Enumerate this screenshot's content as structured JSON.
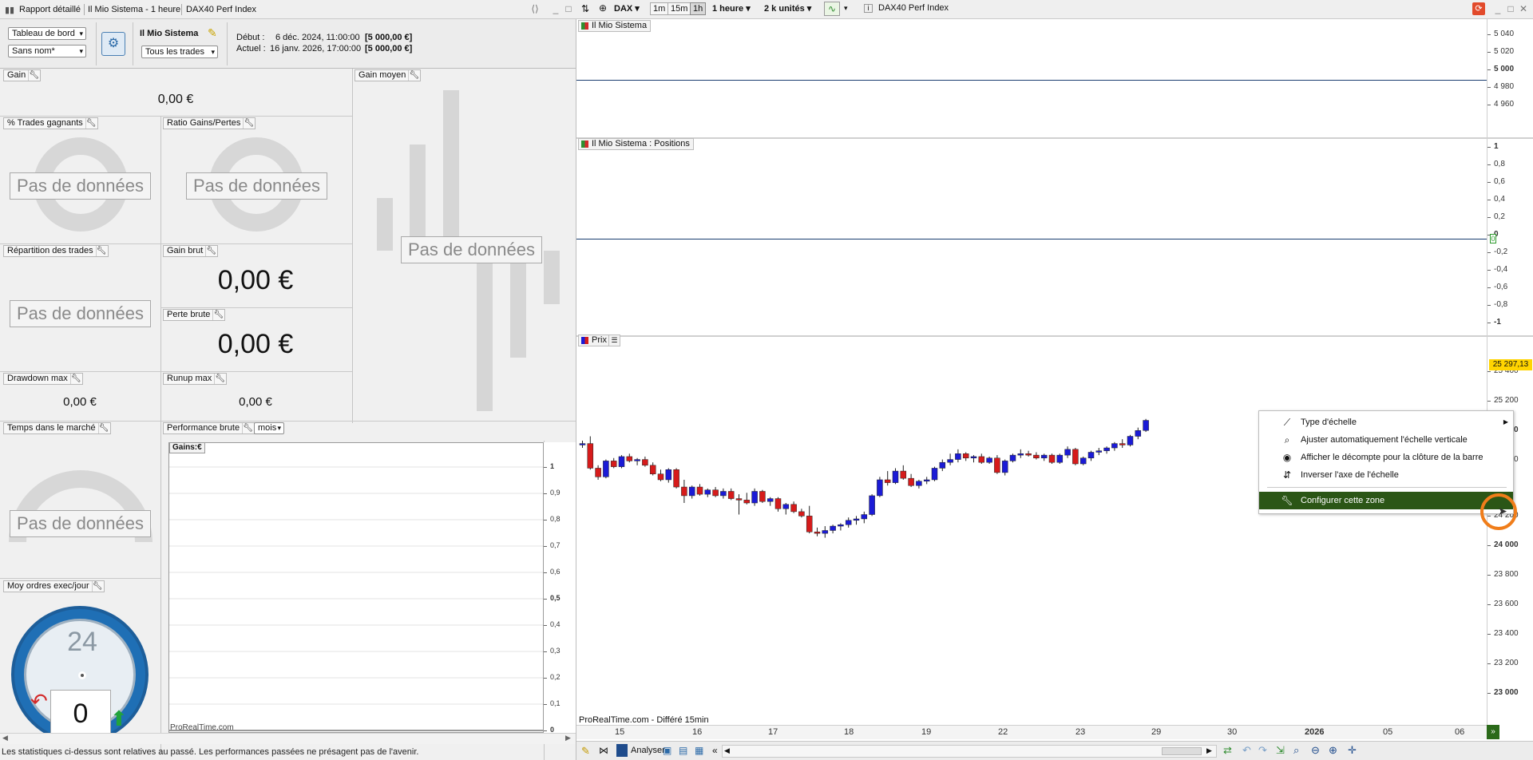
{
  "tabs": {
    "left": [
      "Rapport détaillé",
      "Il Mio Sistema - 1 heure",
      "DAX40 Perf Index"
    ],
    "right_title": "DAX40 Perf Index"
  },
  "toolbar": {
    "symbol": "DAX",
    "timeframes": [
      "1m",
      "15m",
      "1h"
    ],
    "period": "1 heure",
    "units": "2 k unités"
  },
  "report": {
    "view_select": "Tableau de bord",
    "name_select": "Sans nom*",
    "system_name": "Il Mio Sistema",
    "trades_select": "Tous les trades",
    "debut_label": "Début :",
    "debut_value": "6 déc. 2024, 11:00:00",
    "debut_capital": "[5 000,00 €]",
    "actuel_label": "Actuel :",
    "actuel_value": "16 janv. 2026, 17:00:00",
    "actuel_capital": "[5 000,00 €]"
  },
  "widgets": {
    "gain": {
      "title": "Gain",
      "value": "0,00 €"
    },
    "gain_moyen": {
      "title": "Gain moyen"
    },
    "pct_trades": {
      "title": "% Trades gagnants"
    },
    "ratio": {
      "title": "Ratio Gains/Pertes"
    },
    "repartition": {
      "title": "Répartition des trades"
    },
    "gain_brut": {
      "title": "Gain brut",
      "value": "0,00 €"
    },
    "perte_brute": {
      "title": "Perte brute",
      "value": "0,00 €"
    },
    "drawdown": {
      "title": "Drawdown max",
      "value": "0,00 €"
    },
    "runup": {
      "title": "Runup max",
      "value": "0,00 €"
    },
    "temps": {
      "title": "Temps dans le marché"
    },
    "perf": {
      "title": "Performance brute",
      "period": "mois",
      "legend": "Gains:€",
      "watermark": "ProRealTime.com",
      "yticks": [
        "1",
        "0,9",
        "0,8",
        "0,7",
        "0,6",
        "0,5",
        "0,4",
        "0,3",
        "0,2",
        "0,1",
        "0"
      ]
    },
    "ordres": {
      "title": "Moy ordres exec/jour",
      "clock_value": "24",
      "count": "0"
    },
    "no_data": "Pas de données"
  },
  "footer": {
    "disclaimer": "Les statistiques ci-dessus sont relatives au passé. Les performances passées ne présagent pas de l'avenir."
  },
  "chart": {
    "pane1": {
      "label": "Il Mio Sistema",
      "yticks": [
        "5 040",
        "5 020",
        "5 000",
        "4 980",
        "4 960"
      ]
    },
    "pane2": {
      "label": "Il Mio Sistema : Positions",
      "yticks": [
        "1",
        "0,8",
        "0,6",
        "0,4",
        "0,2",
        "0",
        "-0,2",
        "-0,4",
        "-0,6",
        "-0,8",
        "-1"
      ]
    },
    "pane3": {
      "label": "Prix",
      "last_price": "25 297,13",
      "yticks": [
        "25 400",
        "25 200",
        "25 000",
        "24 800",
        "24 200",
        "24 000",
        "23 800",
        "23 600",
        "23 400",
        "23 200",
        "23 000"
      ]
    },
    "source": "ProRealTime.com - Différé 15min",
    "xticks": [
      "15",
      "16",
      "17",
      "18",
      "19",
      "22",
      "23",
      "29",
      "30",
      "2026",
      "05",
      "06"
    ],
    "analyser": "Analyser"
  },
  "context_menu": {
    "items": [
      {
        "label": "Type d'échelle",
        "icon": "scale-type-icon"
      },
      {
        "label": "Ajuster automatiquement l'échelle verticale",
        "icon": "auto-scale-icon"
      },
      {
        "label": "Afficher le décompte pour la clôture de la barre",
        "icon": "eye-icon"
      },
      {
        "label": "Inverser l'axe de l'échelle",
        "icon": "invert-axis-icon"
      },
      {
        "label": "Configurer cette zone",
        "icon": "wrench-icon"
      }
    ]
  },
  "colors": {
    "up": "#1b1bd6",
    "down": "#d61b1b",
    "menu_highlight": "#2b5616",
    "cursor_ring": "#f07d1a",
    "price_tag": "#ffd400"
  },
  "chart_data": {
    "type": "candlestick",
    "xlabel": "",
    "ylabel": "",
    "ohlc": [
      [
        24860,
        24890,
        24840,
        24870
      ],
      [
        24870,
        24920,
        24690,
        24700
      ],
      [
        24700,
        24720,
        24620,
        24640
      ],
      [
        24640,
        24760,
        24630,
        24750
      ],
      [
        24750,
        24770,
        24700,
        24710
      ],
      [
        24710,
        24790,
        24700,
        24780
      ],
      [
        24780,
        24800,
        24740,
        24750
      ],
      [
        24750,
        24770,
        24720,
        24760
      ],
      [
        24760,
        24780,
        24710,
        24720
      ],
      [
        24720,
        24740,
        24650,
        24660
      ],
      [
        24660,
        24690,
        24610,
        24620
      ],
      [
        24620,
        24700,
        24600,
        24690
      ],
      [
        24690,
        24700,
        24560,
        24570
      ],
      [
        24570,
        24620,
        24460,
        24510
      ],
      [
        24510,
        24580,
        24490,
        24570
      ],
      [
        24570,
        24590,
        24510,
        24520
      ],
      [
        24520,
        24560,
        24500,
        24550
      ],
      [
        24550,
        24570,
        24500,
        24510
      ],
      [
        24510,
        24560,
        24490,
        24540
      ],
      [
        24540,
        24560,
        24480,
        24490
      ],
      [
        24490,
        24520,
        24380,
        24480
      ],
      [
        24480,
        24530,
        24450,
        24460
      ],
      [
        24460,
        24560,
        24440,
        24540
      ],
      [
        24540,
        24550,
        24460,
        24470
      ],
      [
        24470,
        24500,
        24440,
        24490
      ],
      [
        24490,
        24500,
        24400,
        24420
      ],
      [
        24420,
        24460,
        24380,
        24450
      ],
      [
        24450,
        24470,
        24390,
        24400
      ],
      [
        24400,
        24420,
        24360,
        24370
      ],
      [
        24370,
        24440,
        24250,
        24260
      ],
      [
        24260,
        24290,
        24230,
        24250
      ],
      [
        24250,
        24300,
        24220,
        24270
      ],
      [
        24270,
        24310,
        24250,
        24300
      ],
      [
        24300,
        24320,
        24270,
        24310
      ],
      [
        24310,
        24360,
        24290,
        24340
      ],
      [
        24340,
        24370,
        24310,
        24350
      ],
      [
        24350,
        24400,
        24320,
        24380
      ],
      [
        24380,
        24520,
        24370,
        24510
      ],
      [
        24510,
        24640,
        24500,
        24620
      ],
      [
        24620,
        24680,
        24580,
        24600
      ],
      [
        24600,
        24700,
        24590,
        24680
      ],
      [
        24680,
        24720,
        24620,
        24630
      ],
      [
        24630,
        24660,
        24570,
        24580
      ],
      [
        24580,
        24620,
        24560,
        24610
      ],
      [
        24610,
        24640,
        24590,
        24620
      ],
      [
        24620,
        24710,
        24610,
        24700
      ],
      [
        24700,
        24760,
        24680,
        24740
      ],
      [
        24740,
        24800,
        24720,
        24760
      ],
      [
        24760,
        24830,
        24740,
        24800
      ],
      [
        24800,
        24810,
        24750,
        24770
      ],
      [
        24770,
        24790,
        24740,
        24780
      ],
      [
        24780,
        24800,
        24730,
        24740
      ],
      [
        24740,
        24780,
        24730,
        24770
      ],
      [
        24770,
        24790,
        24660,
        24670
      ],
      [
        24670,
        24760,
        24650,
        24750
      ],
      [
        24750,
        24800,
        24740,
        24790
      ],
      [
        24790,
        24830,
        24770,
        24800
      ],
      [
        24800,
        24820,
        24780,
        24790
      ],
      [
        24790,
        24810,
        24760,
        24770
      ],
      [
        24770,
        24800,
        24750,
        24790
      ],
      [
        24790,
        24800,
        24730,
        24740
      ],
      [
        24740,
        24800,
        24730,
        24790
      ],
      [
        24790,
        24850,
        24770,
        24830
      ],
      [
        24830,
        24840,
        24720,
        24730
      ],
      [
        24730,
        24780,
        24720,
        24770
      ],
      [
        24770,
        24820,
        24750,
        24810
      ],
      [
        24810,
        24840,
        24790,
        24820
      ],
      [
        24820,
        24850,
        24800,
        24840
      ],
      [
        24840,
        24880,
        24820,
        24870
      ],
      [
        24870,
        24900,
        24840,
        24860
      ],
      [
        24860,
        24930,
        24850,
        24920
      ],
      [
        24920,
        24980,
        24900,
        24960
      ],
      [
        24960,
        25040,
        24950,
        25030
      ]
    ]
  }
}
